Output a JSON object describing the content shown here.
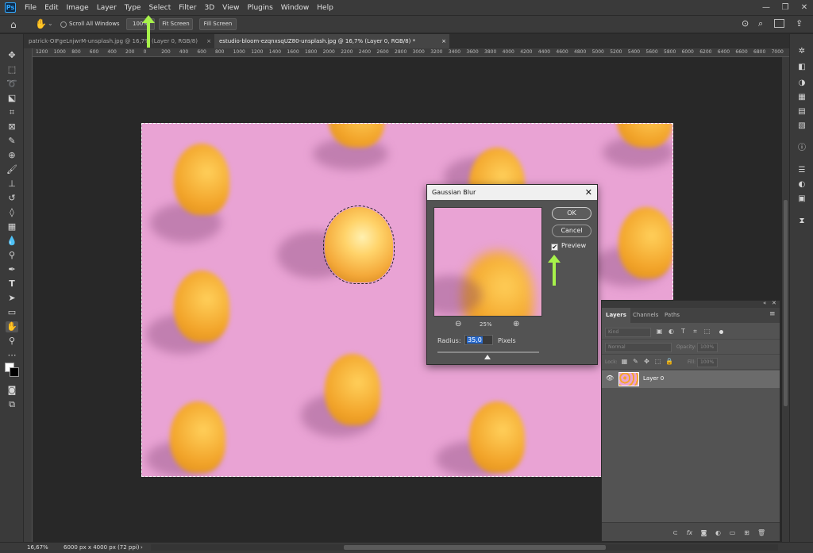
{
  "app": {
    "logo": "Ps"
  },
  "menu": [
    "File",
    "Edit",
    "Image",
    "Layer",
    "Type",
    "Select",
    "Filter",
    "3D",
    "View",
    "Plugins",
    "Window",
    "Help"
  ],
  "window_controls": {
    "minimize": "—",
    "maximize": "❐",
    "close": "✕"
  },
  "options_bar": {
    "home_icon": "home-icon",
    "hand_tool_icon": "hand-icon",
    "scroll_all_windows": "Scroll All Windows",
    "zoom_100": "100%",
    "fit_screen": "Fit Screen",
    "fill_screen": "Fill Screen"
  },
  "tabs": [
    {
      "label": "patrick-OIFgeLnjwrM-unsplash.jpg @ 16,7% (Layer 0, RGB/8)",
      "close": "×"
    },
    {
      "label": "estudio-bloom-ezqnxsqUZ80-unsplash.jpg @ 16,7% (Layer 0, RGB/8) *",
      "close": "×"
    }
  ],
  "ruler_ticks": [
    "1200",
    "1000",
    "800",
    "600",
    "400",
    "200",
    "0",
    "200",
    "400",
    "600",
    "800",
    "1000",
    "1200",
    "1400",
    "1600",
    "1800",
    "2000",
    "2200",
    "2400",
    "2600",
    "2800",
    "3000",
    "3200",
    "3400",
    "3600",
    "3800",
    "4000",
    "4200",
    "4400",
    "4600",
    "4800",
    "5000",
    "5200",
    "5400",
    "5600",
    "5800",
    "6000",
    "6200",
    "6400",
    "6600",
    "6800",
    "7000"
  ],
  "dialog": {
    "title": "Gaussian Blur",
    "close": "✕",
    "ok": "OK",
    "cancel": "Cancel",
    "preview_label": "Preview",
    "preview_checked": "✔",
    "zoom_out": "⊖",
    "zoom_in": "⊕",
    "zoom_pct": "25%",
    "radius_label": "Radius:",
    "radius_value": "35,0",
    "radius_unit": "Pixels"
  },
  "layers_panel": {
    "tabs": [
      "Layers",
      "Channels",
      "Paths"
    ],
    "menu_icon": "≡",
    "kind_placeholder": "Kind",
    "blend_mode": "Normal",
    "opacity_label": "Opacity:",
    "opacity_value": "100%",
    "lock_label": "Lock:",
    "fill_label": "Fill:",
    "fill_value": "100%",
    "layer_name": "Layer 0",
    "visibility": "👁"
  },
  "status": {
    "zoom": "16,67%",
    "doc_info": "6000 px x 4000 px (72 ppi)",
    "arrow": "›"
  },
  "colors": {
    "canvas_bg": "#e9a3d4",
    "lemon": "#f6a62a",
    "accent_arrow": "#a7f24a",
    "ui_panel": "#535353"
  }
}
